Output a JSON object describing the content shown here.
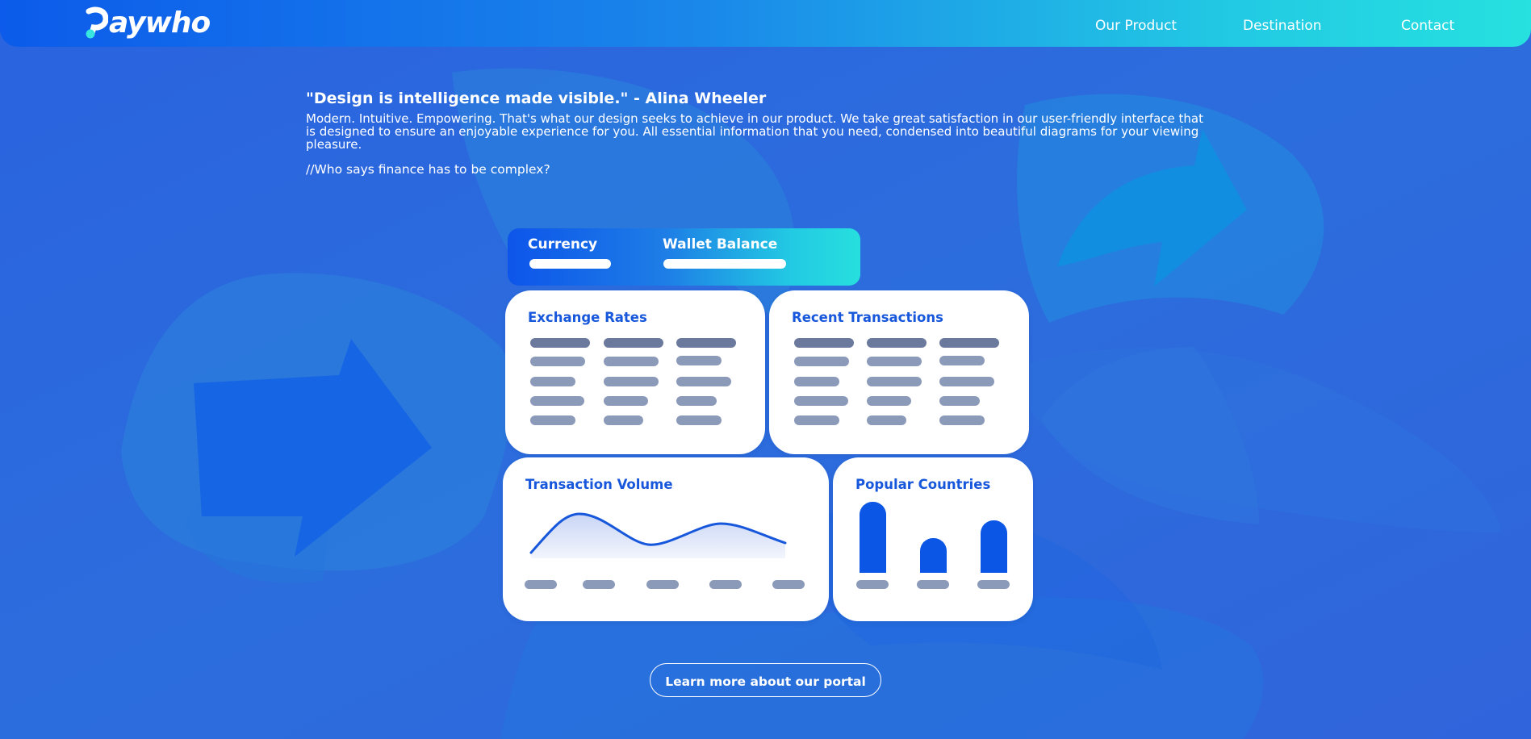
{
  "brand": {
    "name": "Paywho",
    "logo_text": "aywho",
    "accent_color": "#1757db",
    "header_gradient": [
      "#0c5bea",
      "#26e1e0"
    ]
  },
  "nav": {
    "items": [
      {
        "label": "Our Product"
      },
      {
        "label": "Destination"
      },
      {
        "label": "Contact"
      }
    ]
  },
  "intro": {
    "quote": "\"Design is intelligence made visible.\" - Alina Wheeler",
    "description": "Modern. Intuitive. Empowering. That's what our design seeks to achieve in our product. We take great satisfaction in our user-friendly interface that is designed to ensure an enjoyable experience for you. All essential information that you need, condensed into beautiful diagrams for your viewing pleasure.",
    "tagline": "//Who says finance has to be complex?"
  },
  "dashboard": {
    "tabs": [
      {
        "label": "Currency"
      },
      {
        "label": "Wallet Balance"
      }
    ],
    "cards": {
      "exchange_rates": {
        "title": "Exchange Rates"
      },
      "recent_transactions": {
        "title": "Recent Transactions"
      },
      "transaction_volume": {
        "title": "Transaction Volume"
      },
      "popular_countries": {
        "title": "Popular Countries"
      }
    }
  },
  "cta": {
    "label": "Learn more about our portal"
  },
  "icons": [
    "paywho-logo-icon"
  ]
}
